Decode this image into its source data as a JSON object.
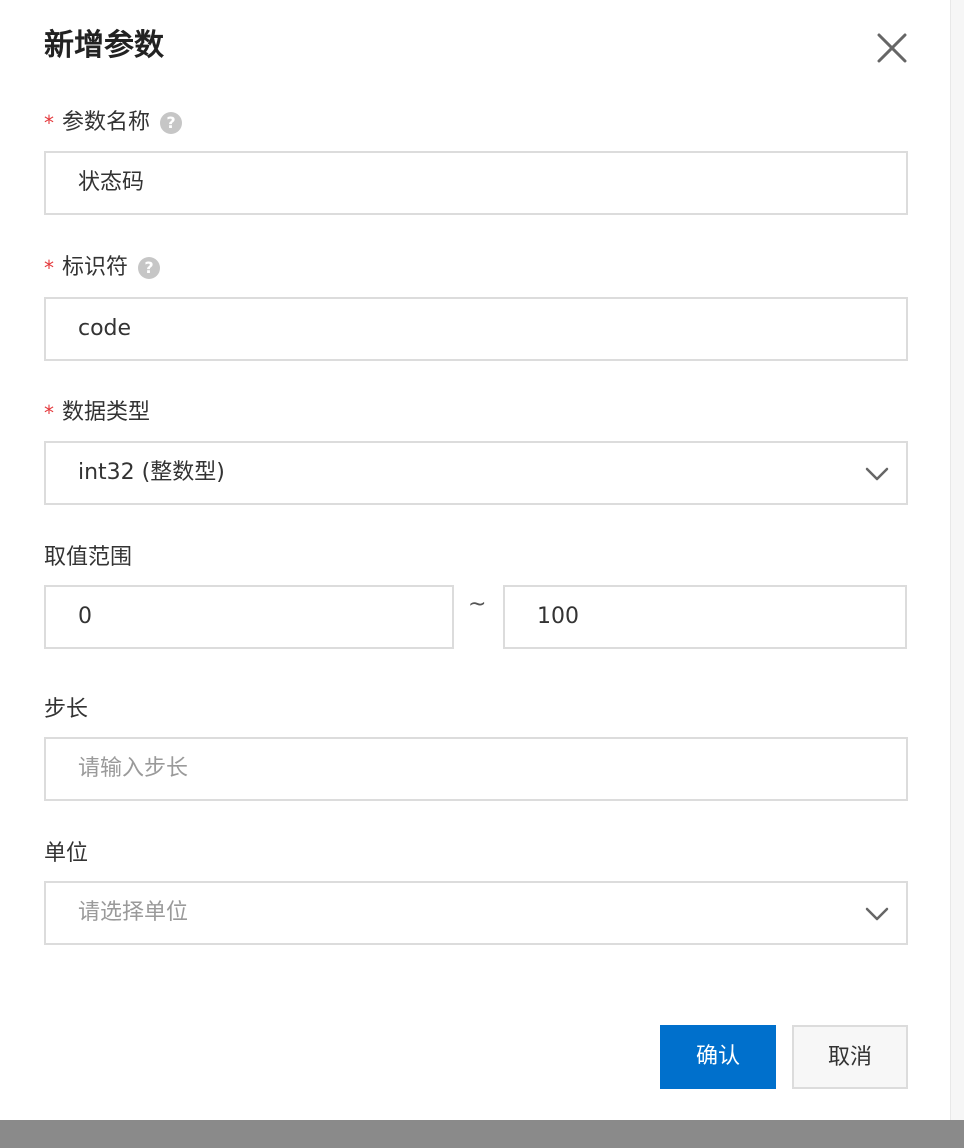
{
  "dialog": {
    "title": "新增参数",
    "close_icon": "close-icon"
  },
  "fields": {
    "param_name": {
      "label": "参数名称",
      "required_mark": "*",
      "help_glyph": "?",
      "value": "状态码"
    },
    "identifier": {
      "label": "标识符",
      "required_mark": "*",
      "help_glyph": "?",
      "value": "code"
    },
    "data_type": {
      "label": "数据类型",
      "required_mark": "*",
      "selected": "int32 (整数型)"
    },
    "value_range": {
      "label": "取值范围",
      "min": "0",
      "separator": "~",
      "max": "100"
    },
    "step": {
      "label": "步长",
      "placeholder": "请输入步长"
    },
    "unit": {
      "label": "单位",
      "placeholder": "请选择单位"
    }
  },
  "actions": {
    "confirm_label": "确认",
    "cancel_label": "取消"
  },
  "colors": {
    "primary": "#0070cc",
    "required": "#e4393c",
    "border": "#dcdcdc",
    "placeholder": "#9a9a9a"
  }
}
